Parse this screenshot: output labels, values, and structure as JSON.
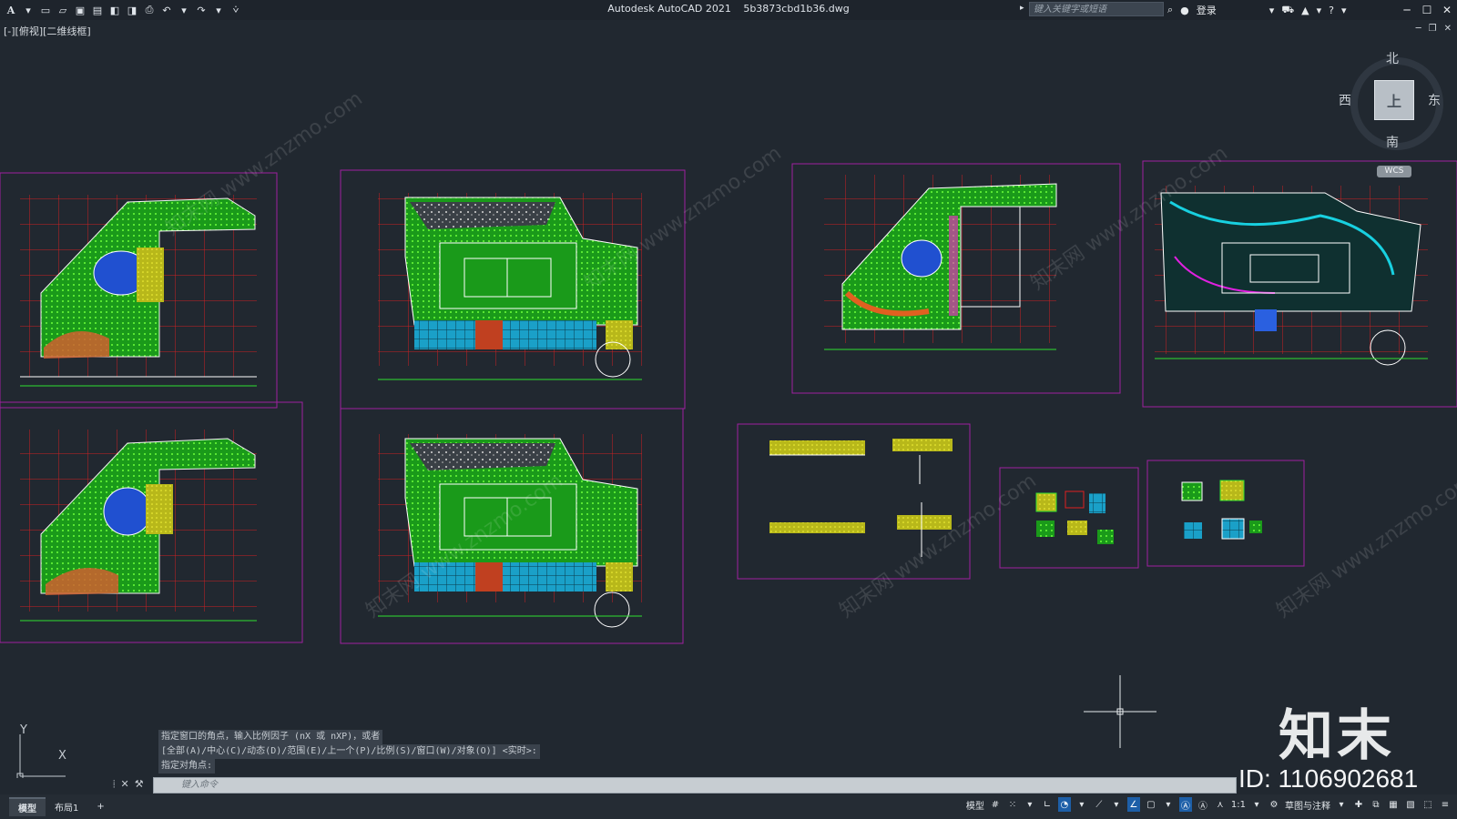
{
  "app": {
    "title": "Autodesk AutoCAD 2021",
    "file": "5b3873cbd1b36.dwg"
  },
  "search": {
    "placeholder": "键入关键字或短语"
  },
  "account": {
    "login": "登录"
  },
  "view": {
    "label": "[-][俯视][二维线框]"
  },
  "viewcube": {
    "north": "北",
    "south": "南",
    "east": "东",
    "west": "西",
    "face": "上",
    "wcs": "WCS"
  },
  "ucs": {
    "x": "X",
    "y": "Y"
  },
  "command": {
    "history": [
      "指定窗口的角点，输入比例因子 (nX 或 nXP)，或者",
      "[全部(A)/中心(C)/动态(D)/范围(E)/上一个(P)/比例(S)/窗口(W)/对象(O)] <实时>:",
      "指定对角点:"
    ],
    "placeholder": "键入命令"
  },
  "tabs": [
    {
      "label": "模型"
    },
    {
      "label": "布局1"
    },
    {
      "label": "+"
    }
  ],
  "status": {
    "model": "模型",
    "scale": "1:1",
    "workspace": "草图与注释"
  },
  "watermark": {
    "brand": "知末",
    "id": "ID: 1106902681",
    "text": "知末网 www.znzmo.com"
  }
}
